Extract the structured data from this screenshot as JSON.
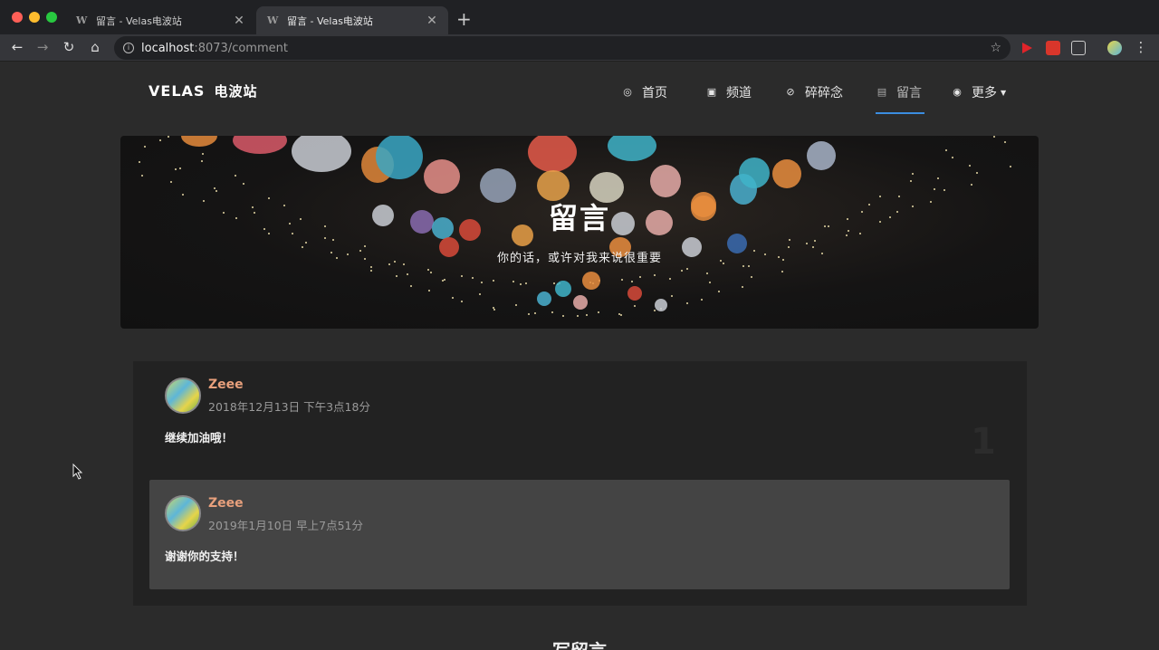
{
  "browser": {
    "tabs": [
      {
        "title": "留言 - Velas电波站",
        "favicon": "W"
      },
      {
        "title": "留言 - Velas电波站",
        "favicon": "W"
      }
    ],
    "url_host": "localhost",
    "url_path": ":8073/comment"
  },
  "site": {
    "logo_main": "VELAS",
    "logo_sub": "电波站",
    "nav": [
      {
        "label": "首页",
        "icon": "radio-waves-icon"
      },
      {
        "label": "频道",
        "icon": "radio-icon"
      },
      {
        "label": "碎碎念",
        "icon": "planet-icon"
      },
      {
        "label": "留言",
        "icon": "calendar-icon"
      },
      {
        "label": "更多",
        "icon": "record-icon"
      }
    ],
    "active_nav": "留言"
  },
  "hero": {
    "title": "留言",
    "subtitle": "你的话，或许对我来说很重要"
  },
  "comment": {
    "author": "Zeee",
    "time": "2018年12月13日 下午3点18分",
    "text": "继续加油哦！",
    "floor": "1",
    "reply": {
      "author": "Zeee",
      "time": "2019年1月10日 早上7点51分",
      "text": "谢谢你的支持！"
    }
  },
  "write": {
    "title": "写留言"
  },
  "colors": {
    "accent": "#3b8de0",
    "author": "#e8a07c",
    "background": "#2b2b2b"
  }
}
